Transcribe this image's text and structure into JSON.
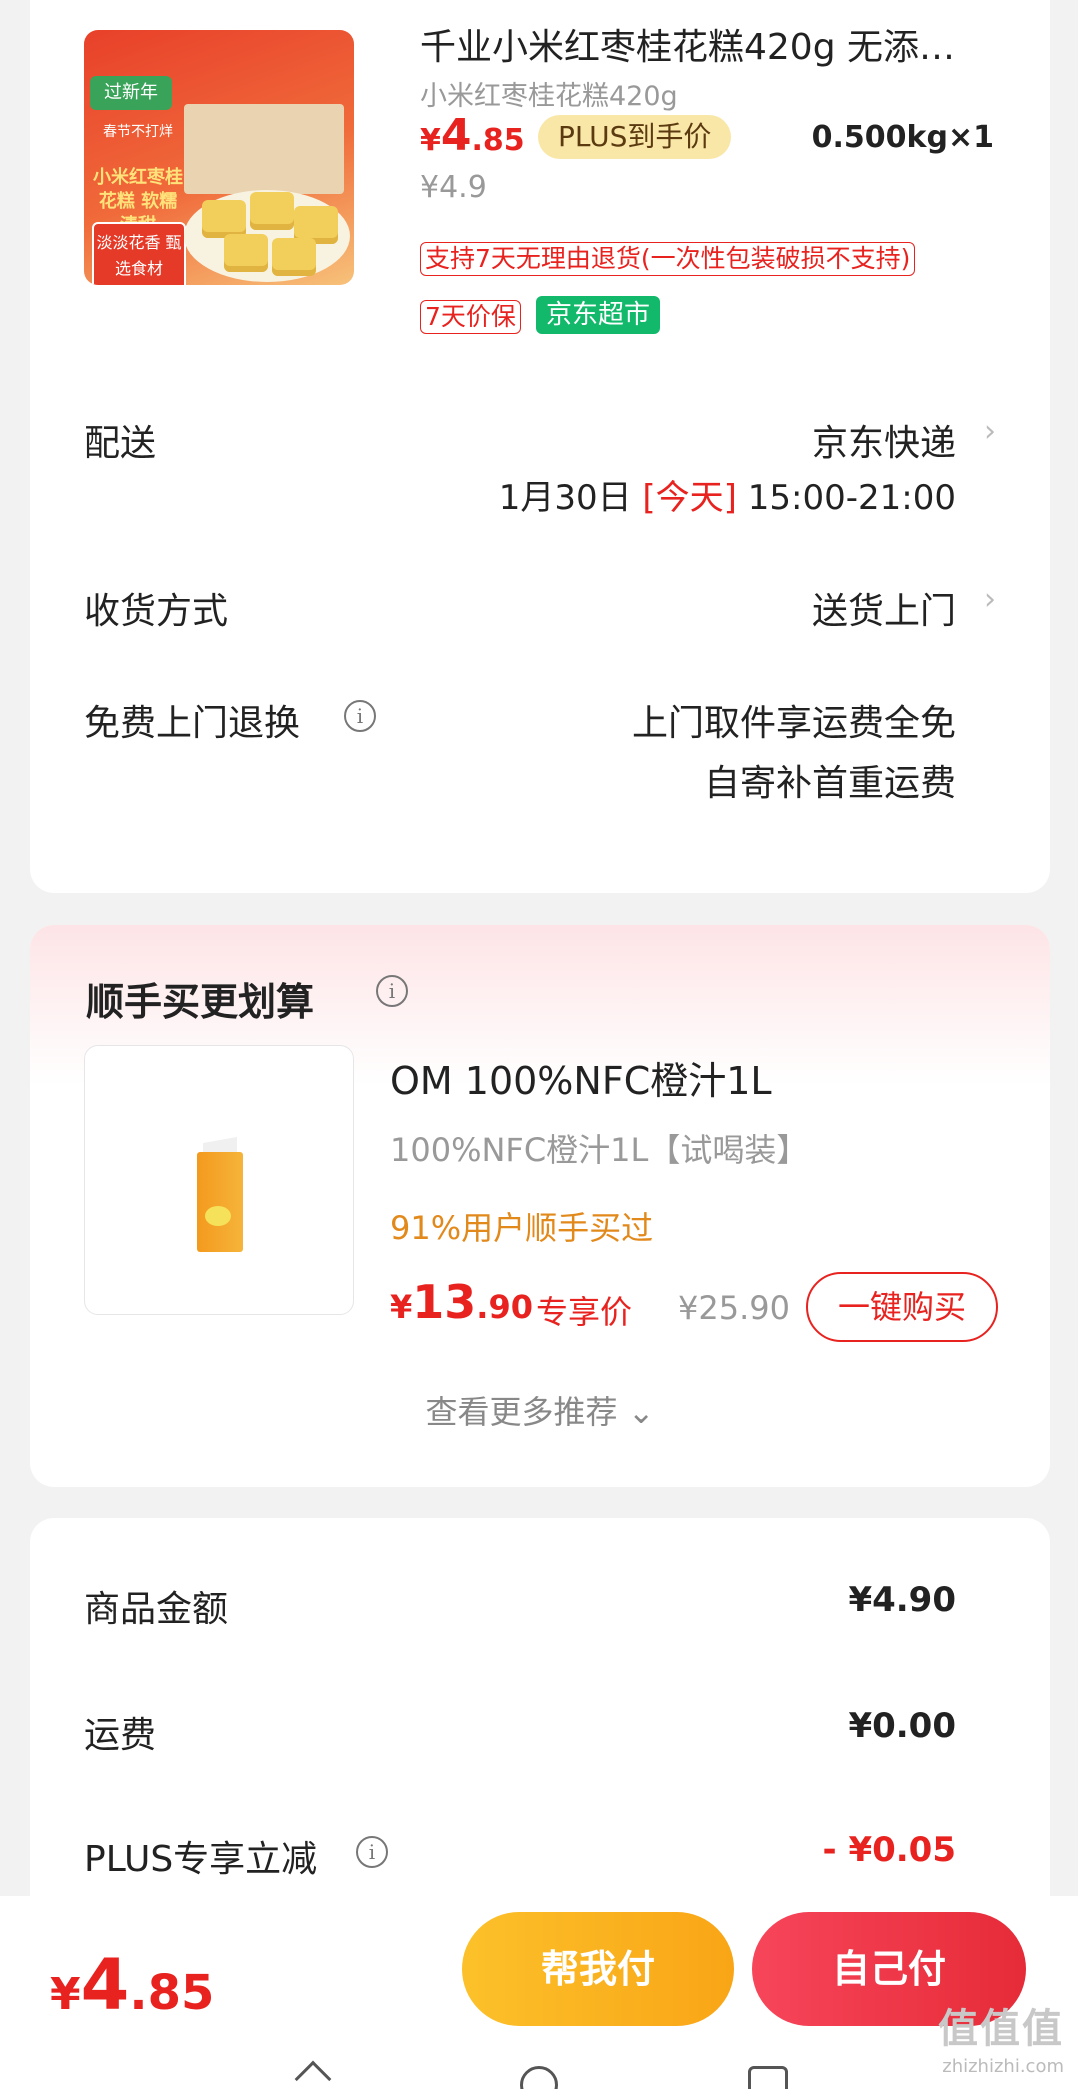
{
  "product": {
    "title": "千业小米红枣桂花糕420g 无添…",
    "spec": "小米红枣桂花糕420g",
    "price_currency": "¥",
    "price_int": "4",
    "price_dec": ".85",
    "plus_tag": "PLUS到手价",
    "quantity": "0.500kg×1",
    "original_price": "¥4.9",
    "return_tag": "支持7天无理由退货(一次性包装破损不支持)",
    "price_protect_tag": "7天价保",
    "store_tag": "京东超市",
    "image_text": {
      "ribbon": "过新年",
      "line1": "春节不打烊",
      "line2": "小米红枣桂花糕 软糯清甜",
      "line3": "淡淡花香 甄选食材"
    }
  },
  "delivery": {
    "label": "配送",
    "carrier": "京东快递",
    "date": "1月30日",
    "today": "[今天]",
    "time": "15:00-21:00"
  },
  "receive": {
    "label": "收货方式",
    "value": "送货上门"
  },
  "free_return": {
    "label": "免费上门退换",
    "line1": "上门取件享运费全免",
    "line2": "自寄补首重运费"
  },
  "addon": {
    "title": "顺手买更划算",
    "name": "OM 100%NFC橙汁1L",
    "spec": "100%NFC橙汁1L【试喝装】",
    "buy_stat": "91%用户顺手买过",
    "price_currency": "¥",
    "price_int": "13",
    "price_dec": ".90",
    "exclusive": "专享价",
    "original_price": "¥25.90",
    "buy_button": "一键购买",
    "more": "查看更多推荐",
    "more_chevron": "⌄"
  },
  "summary": {
    "goods_label": "商品金额",
    "goods_value": "¥4.90",
    "shipping_label": "运费",
    "shipping_value": "¥0.00",
    "plus_label": "PLUS专享立减",
    "plus_value": "- ¥0.05"
  },
  "footer": {
    "total_currency": "¥",
    "total_int": "4",
    "total_dec": ".85",
    "help_pay": "帮我付",
    "self_pay": "自己付",
    "watermark": "值值值",
    "watermark_sub": "zhizhizhi.com"
  },
  "icons": {
    "chevron": "›",
    "info": "i"
  },
  "colors": {
    "accent_red": "#e8231f",
    "plus_gold": "#f9e7a8",
    "jd_green": "#12b96b",
    "help_btn": "#fcc12a",
    "self_btn": "#e62b38"
  }
}
